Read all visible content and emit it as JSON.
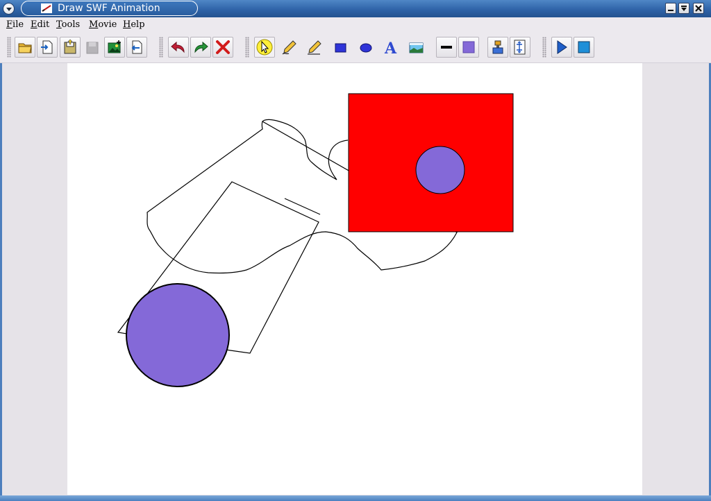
{
  "window": {
    "title": "Draw SWF Animation",
    "title_bar_color": "#2f63a8",
    "controls": {
      "minimize": "minimize-icon",
      "maximize": "maximize-icon",
      "close": "close-icon"
    }
  },
  "menubar": {
    "items": [
      {
        "label": "File",
        "mnemonic": "F",
        "rest": "ile"
      },
      {
        "label": "Edit",
        "mnemonic": "E",
        "rest": "dit"
      },
      {
        "label": "Tools",
        "mnemonic": "T",
        "rest": "ools"
      },
      {
        "label": "Movie",
        "mnemonic": "M",
        "rest": "ovie"
      },
      {
        "label": "Help",
        "mnemonic": "H",
        "rest": "elp"
      }
    ]
  },
  "toolbar": {
    "groups": [
      [
        "open-folder-icon",
        "import-icon",
        "save-icon",
        "save-disabled-icon",
        "insert-image-icon",
        "export-icon"
      ],
      [
        "undo-icon",
        "redo-icon",
        "delete-icon"
      ],
      [
        "select-arrow-icon",
        "freehand-pencil-icon",
        "line-pencil-icon",
        "rectangle-icon",
        "ellipse-icon",
        "text-icon",
        "image-icon"
      ],
      [
        "line-color-icon",
        "fill-color-icon"
      ],
      [
        "paint-brush-icon",
        "properties-icon"
      ],
      [
        "play-icon",
        "stop-icon"
      ]
    ],
    "selected_tool": "select-arrow-icon"
  },
  "canvas": {
    "background": "#ffffff",
    "shapes": {
      "rectangle_fill": "#ff0000",
      "circle_fill": "#8469d8",
      "stroke": "#000000"
    }
  }
}
